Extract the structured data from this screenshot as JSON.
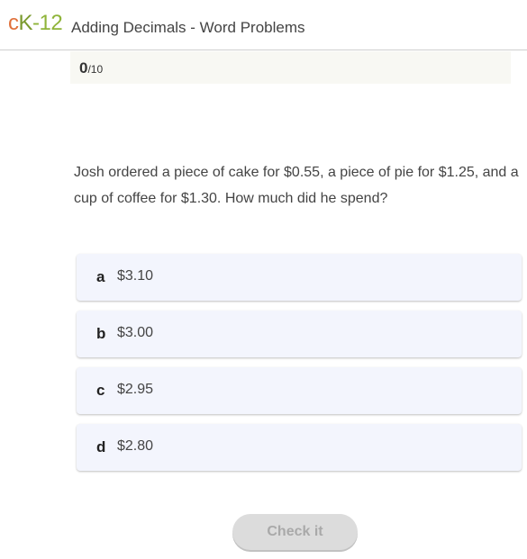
{
  "header": {
    "logo": {
      "c": "c",
      "k": "K",
      "dash_num": "-12"
    },
    "title": "Adding Decimals - Word Problems"
  },
  "score": {
    "current": "0",
    "total": "/10"
  },
  "question": "Josh ordered a piece of cake for $0.55, a piece of pie for $1.25, and a cup of coffee for $1.30. How much did he spend?",
  "options": [
    {
      "letter": "a",
      "text": "$3.10"
    },
    {
      "letter": "b",
      "text": "$3.00"
    },
    {
      "letter": "c",
      "text": "$2.95"
    },
    {
      "letter": "d",
      "text": "$2.80"
    }
  ],
  "check_button": {
    "label": "Check it",
    "state": "disabled"
  },
  "colors": {
    "logo_c": "#e0713b",
    "logo_k": "#7a9a2e",
    "logo_12": "#8fb43a",
    "option_bg": "#f3f5fd",
    "button_bg": "#dcdcdc",
    "button_text": "#a9a9a9"
  }
}
